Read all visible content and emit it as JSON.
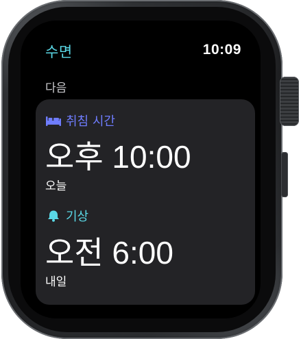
{
  "header": {
    "app_title": "수면",
    "time": "10:09"
  },
  "section": {
    "label": "다음"
  },
  "bedtime": {
    "label": "취침 시간",
    "icon": "bed-icon",
    "time": "오후 10:00",
    "day": "오늘",
    "color": "#6f7dff"
  },
  "wake": {
    "label": "기상",
    "icon": "bell-icon",
    "time": "오전 6:00",
    "day": "내일",
    "color": "#5ad8e6"
  },
  "colors": {
    "accent": "#5ad8e6",
    "card_background": "#232326",
    "screen_background": "#000000"
  }
}
